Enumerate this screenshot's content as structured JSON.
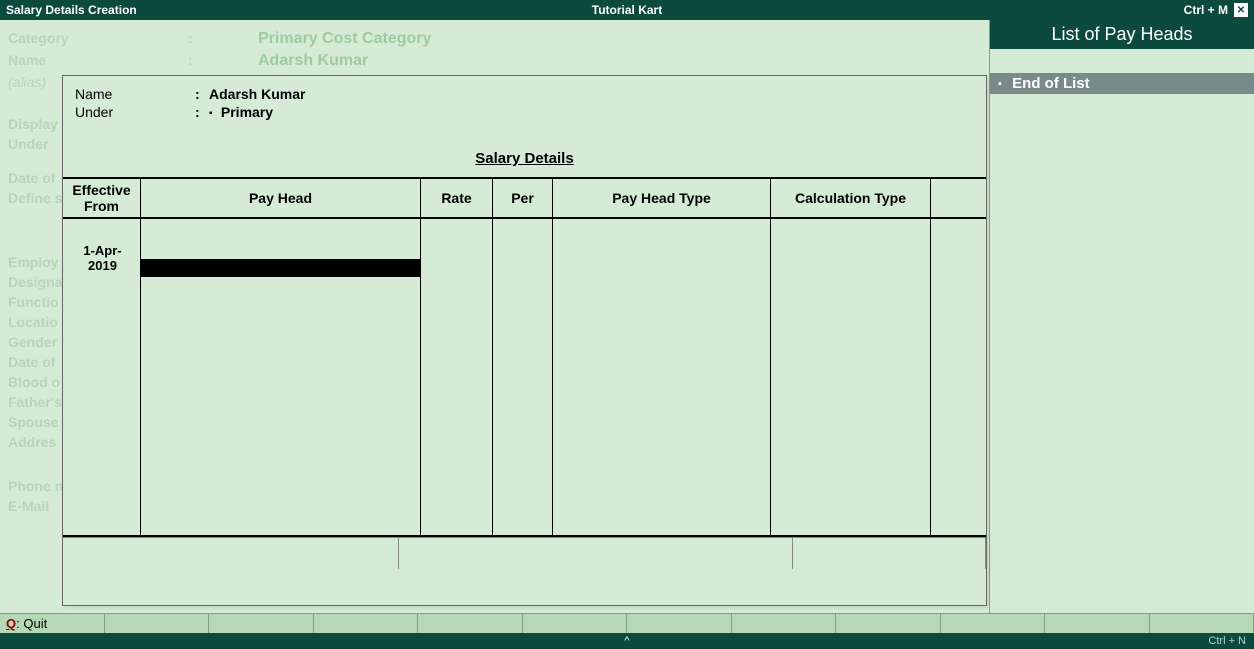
{
  "titlebar": {
    "left": "Salary Details  Creation",
    "center": "Tutorial Kart",
    "shortcut": "Ctrl + M"
  },
  "background_form": {
    "category_label": "Category",
    "category_value": "Primary Cost Category",
    "name_label": "Name",
    "name_value": "Adarsh Kumar",
    "alias_label": "(alias)",
    "display_label": "Display",
    "under_label": "Under",
    "date_of_label": "Date of",
    "define_label": "Define s",
    "emp_labels": [
      "Employ",
      "Designa",
      "Functio",
      "Locatio",
      "Gender",
      "Date of",
      "Blood o",
      "Father's",
      "Spouse",
      "Addres"
    ],
    "phone_label": "Phone no.",
    "email_label": "E-Mail"
  },
  "modal": {
    "name_label": "Name",
    "name_value": "Adarsh Kumar",
    "under_label": "Under",
    "under_value": "Primary",
    "title": "Salary Details",
    "columns": {
      "effective": "Effective From",
      "payhead": "Pay Head",
      "rate": "Rate",
      "per": "Per",
      "pht": "Pay Head Type",
      "calc": "Calculation Type"
    },
    "effective_date": "1-Apr-2019"
  },
  "right_panel": {
    "title": "List of Pay Heads",
    "end": "End of List"
  },
  "button_bar": {
    "quit_key": "Q",
    "quit_label": ": Quit"
  },
  "statusbar": {
    "right": "Ctrl + N"
  }
}
